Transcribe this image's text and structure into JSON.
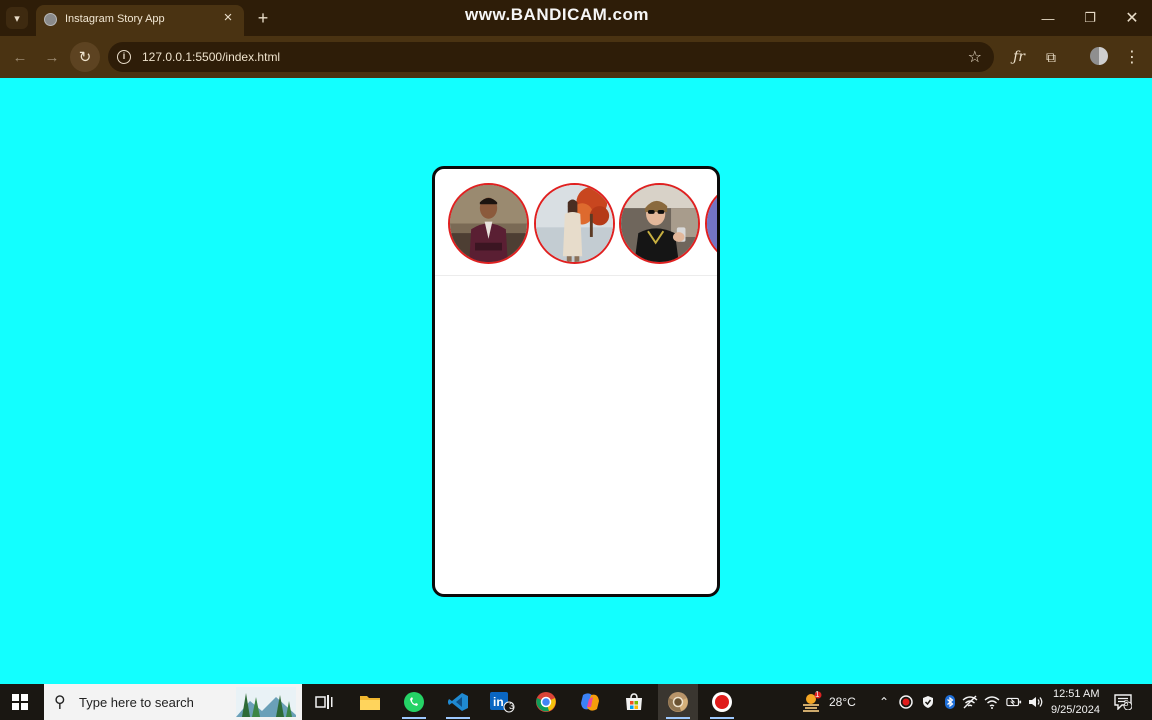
{
  "browser": {
    "tab_title": "Instagram Story App",
    "url": "127.0.0.1:5500/index.html",
    "watermark": "www.BANDICAM.com"
  },
  "colors": {
    "page_background": "#12ffff",
    "story_ring": "#e02020",
    "phone_border": "#0b0b0b"
  },
  "stories": [
    {
      "name": "story-avatar-man-suit",
      "icon": "person-photo"
    },
    {
      "name": "story-avatar-woman-autumn",
      "icon": "person-photo"
    },
    {
      "name": "story-avatar-man-sunglasses",
      "icon": "person-photo"
    },
    {
      "name": "story-avatar-partial",
      "icon": "person-photo"
    }
  ],
  "taskbar": {
    "search_placeholder": "Type here to search",
    "temperature": "28°C",
    "time": "12:51 AM",
    "date": "9/25/2024",
    "linkedin_badge": "3",
    "weather_badge": "1",
    "notification_count": "5"
  }
}
